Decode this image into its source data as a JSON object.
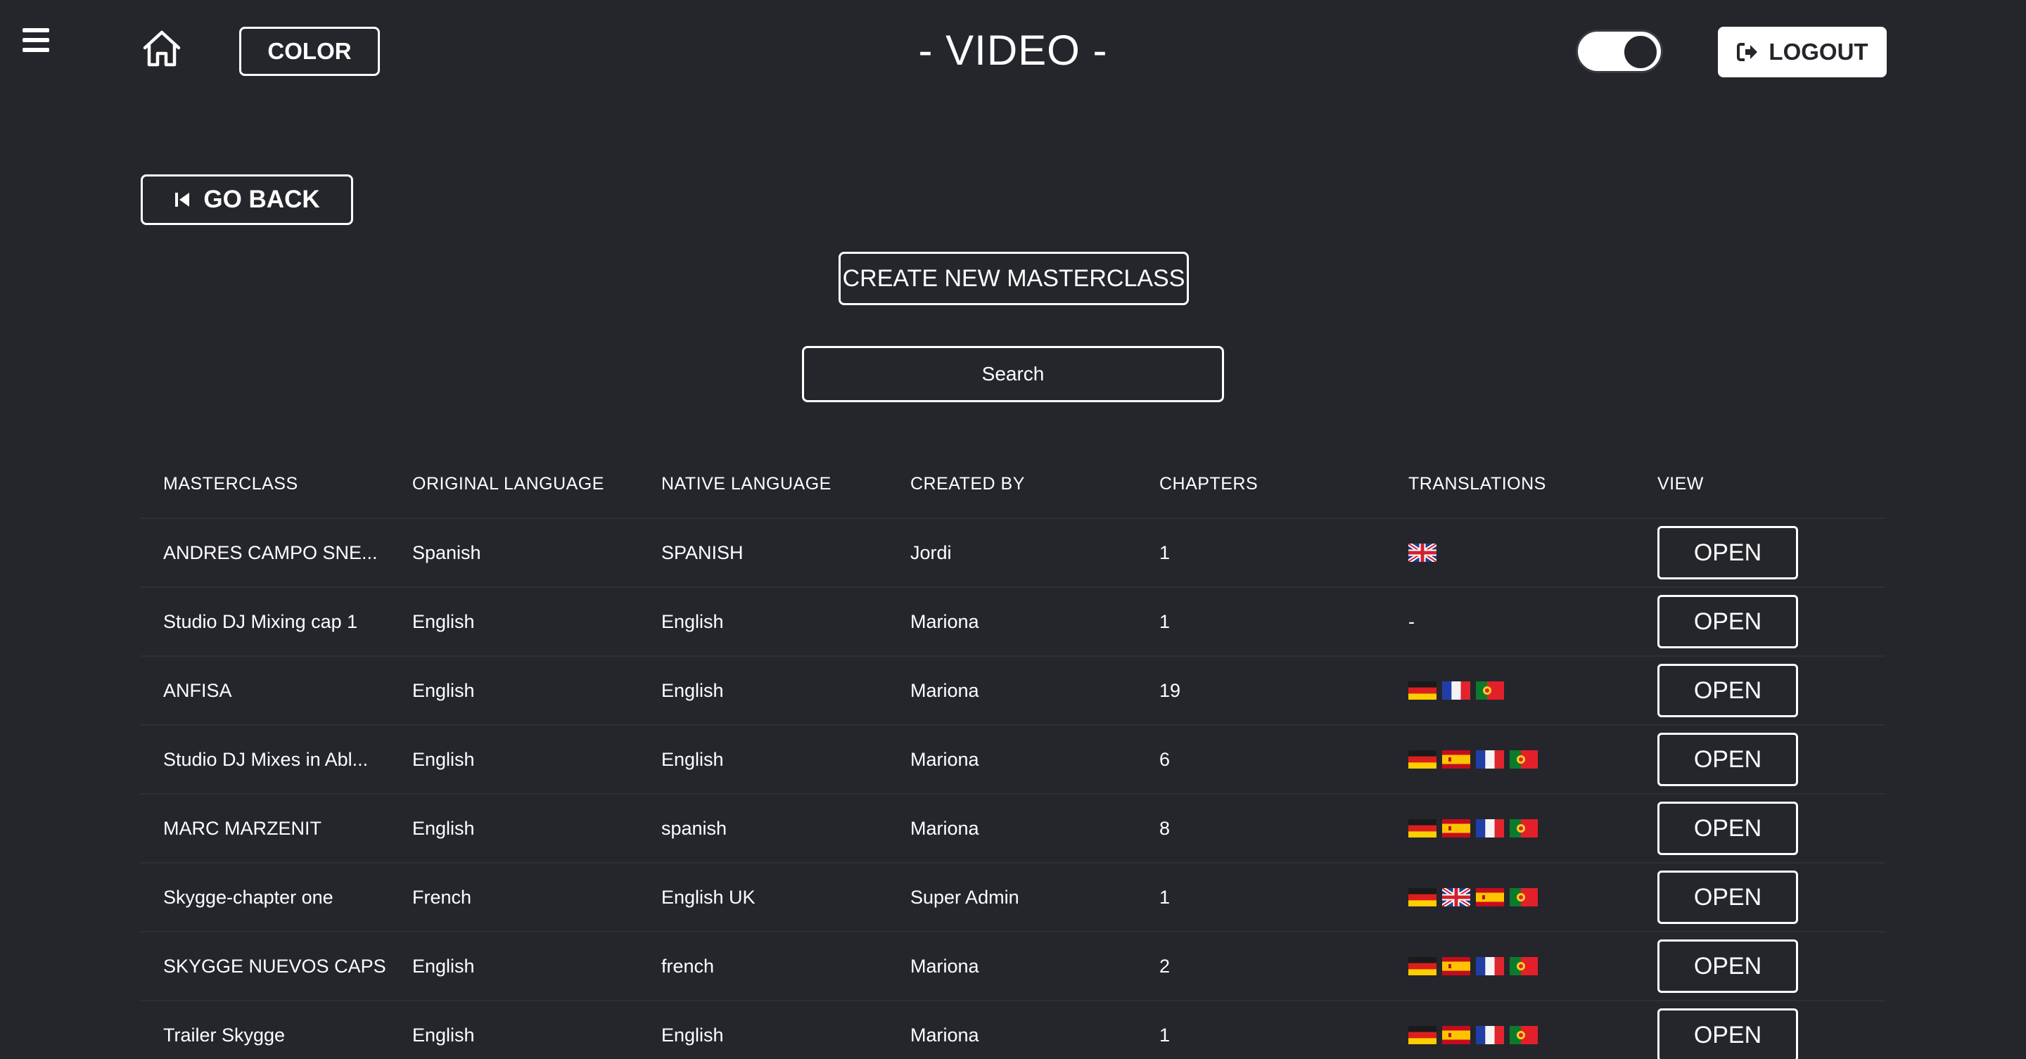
{
  "header": {
    "color_label": "COLOR",
    "title": "- VIDEO -",
    "logout_label": "LOGOUT",
    "toggle_on": true
  },
  "back_label": "GO BACK",
  "create_label": "CREATE NEW MASTERCLASS",
  "search": {
    "placeholder": "Search",
    "value": ""
  },
  "table": {
    "headers": {
      "masterclass": "MASTERCLASS",
      "original_language": "ORIGINAL LANGUAGE",
      "native_language": "NATIVE LANGUAGE",
      "created_by": "CREATED BY",
      "chapters": "CHAPTERS",
      "translations": "TRANSLATIONS",
      "view": "VIEW"
    },
    "open_label": "OPEN",
    "rows": [
      {
        "masterclass": "ANDRES CAMPO SNE...",
        "original_language": "Spanish",
        "native_language": "SPANISH",
        "created_by": "Jordi",
        "chapters": "1",
        "translations": [
          "uk-flag-icon"
        ],
        "translations_text": ""
      },
      {
        "masterclass": "Studio DJ Mixing cap 1",
        "original_language": "English",
        "native_language": "English",
        "created_by": "Mariona",
        "chapters": "1",
        "translations": [],
        "translations_text": "-"
      },
      {
        "masterclass": "ANFISA",
        "original_language": "English",
        "native_language": "English",
        "created_by": "Mariona",
        "chapters": "19",
        "translations": [
          "germany-flag-icon",
          "france-flag-icon",
          "portugal-flag-icon"
        ],
        "translations_text": ""
      },
      {
        "masterclass": "Studio DJ Mixes in Abl...",
        "original_language": "English",
        "native_language": "English",
        "created_by": "Mariona",
        "chapters": "6",
        "translations": [
          "germany-flag-icon",
          "spain-flag-icon",
          "france-flag-icon",
          "portugal-flag-icon"
        ],
        "translations_text": ""
      },
      {
        "masterclass": "MARC MARZENIT",
        "original_language": "English",
        "native_language": "spanish",
        "created_by": "Mariona",
        "chapters": "8",
        "translations": [
          "germany-flag-icon",
          "spain-flag-icon",
          "france-flag-icon",
          "portugal-flag-icon"
        ],
        "translations_text": ""
      },
      {
        "masterclass": "Skygge-chapter one",
        "original_language": "French",
        "native_language": "English UK",
        "created_by": "Super Admin",
        "chapters": "1",
        "translations": [
          "germany-flag-icon",
          "uk-flag-icon",
          "spain-flag-icon",
          "portugal-flag-icon"
        ],
        "translations_text": ""
      },
      {
        "masterclass": "SKYGGE NUEVOS CAPS",
        "original_language": "English",
        "native_language": "french",
        "created_by": "Mariona",
        "chapters": "2",
        "translations": [
          "germany-flag-icon",
          "spain-flag-icon",
          "france-flag-icon",
          "portugal-flag-icon"
        ],
        "translations_text": ""
      },
      {
        "masterclass": "Trailer Skygge",
        "original_language": "English",
        "native_language": "English",
        "created_by": "Mariona",
        "chapters": "1",
        "translations": [
          "germany-flag-icon",
          "spain-flag-icon",
          "france-flag-icon",
          "portugal-flag-icon"
        ],
        "translations_text": ""
      }
    ]
  },
  "colors": {
    "background": "#25262b",
    "foreground": "#ffffff"
  }
}
